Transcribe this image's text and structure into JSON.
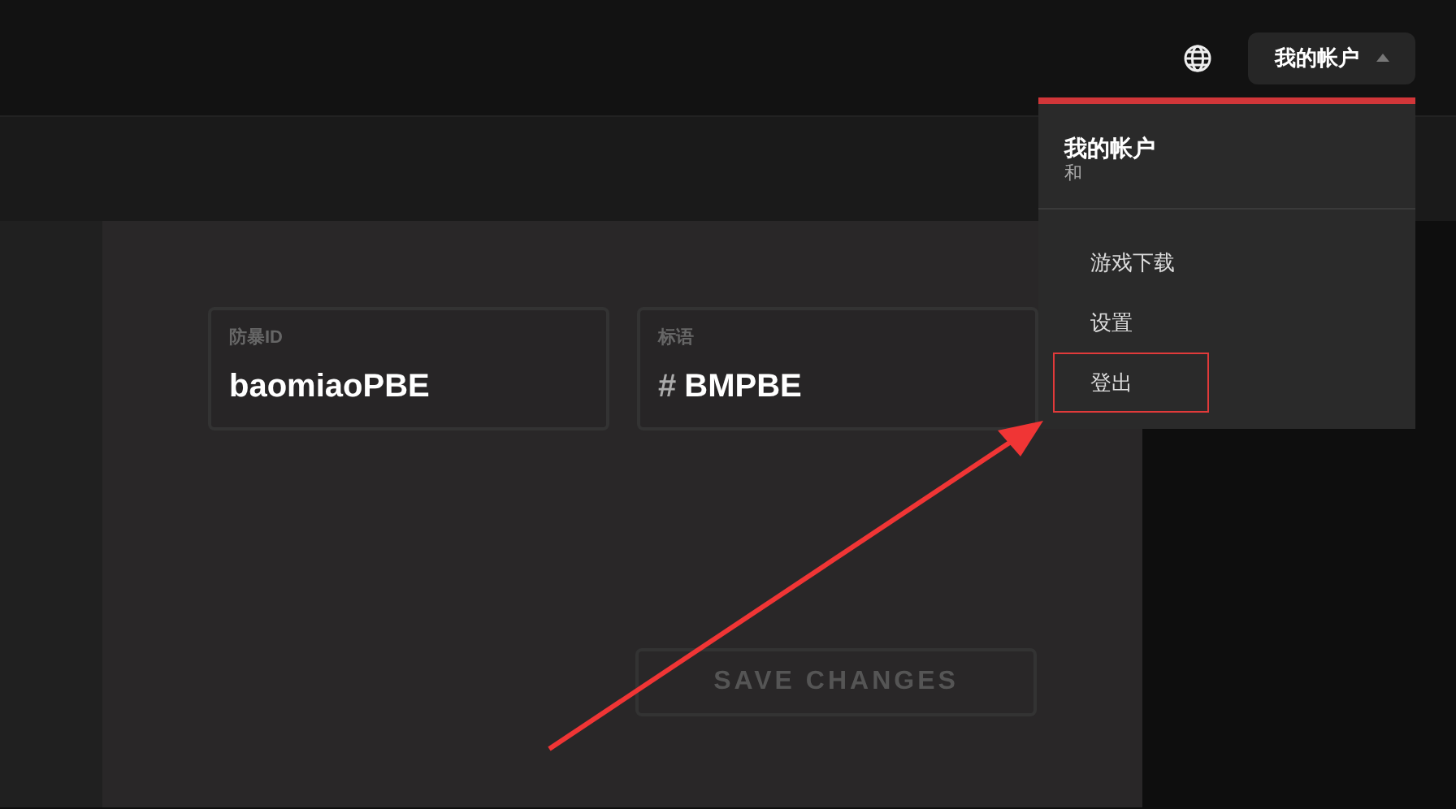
{
  "account_button": {
    "label": "我的帐户",
    "expanded": true
  },
  "account_menu": {
    "title": "我的帐户",
    "subtitle": "和",
    "items": [
      {
        "label": "游戏下载",
        "annotated": false
      },
      {
        "label": "设置",
        "annotated": false
      },
      {
        "label": "登出",
        "annotated": true
      }
    ]
  },
  "fields": [
    {
      "label": "防暴ID",
      "value": "baomiaoPBE"
    },
    {
      "label": "标语",
      "prefix": "#",
      "value": "BMPBE"
    }
  ],
  "save_button": {
    "label": "SAVE CHANGES",
    "disabled": true
  }
}
